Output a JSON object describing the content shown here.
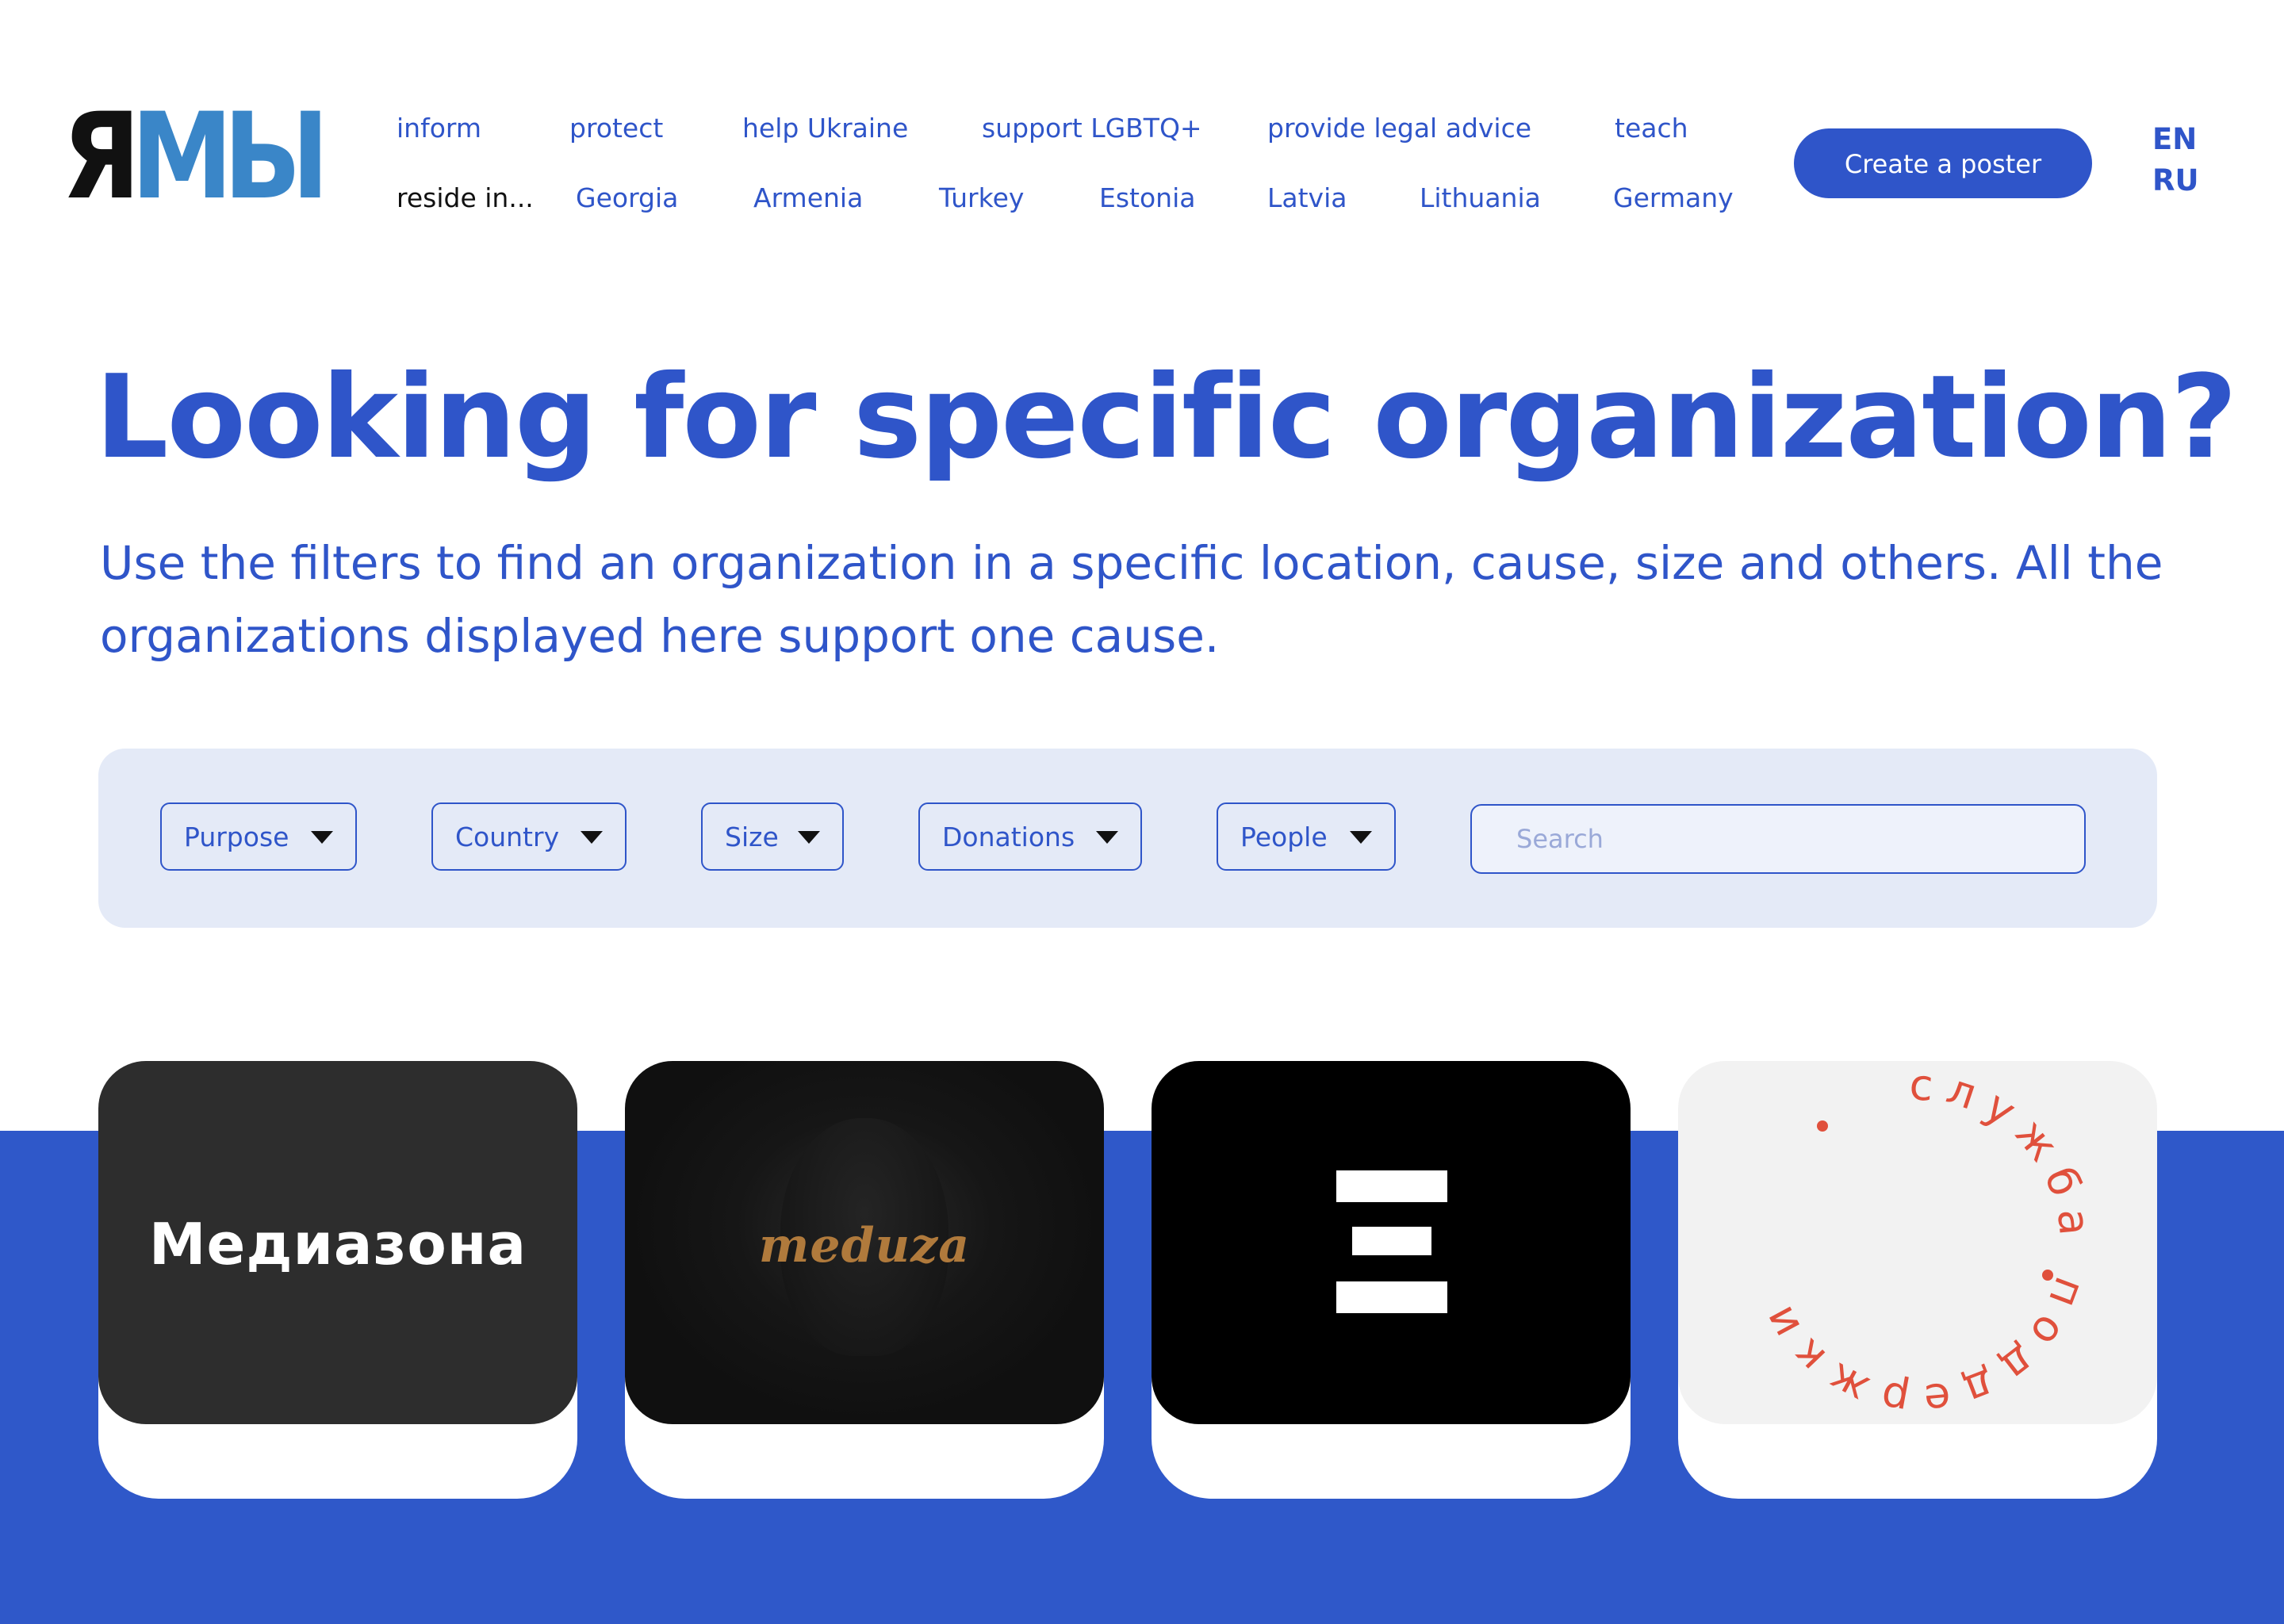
{
  "logo": {
    "part1": "Я",
    "part2": "МЫ"
  },
  "nav": {
    "row1": [
      "inform",
      "protect",
      "help Ukraine",
      "support LGBTQ+",
      "provide legal advice",
      "teach"
    ],
    "reside_label": "reside in...",
    "row2": [
      "Georgia",
      "Armenia",
      "Turkey",
      "Estonia",
      "Latvia",
      "Lithuania",
      "Germany"
    ]
  },
  "header": {
    "cta_label": "Create a poster",
    "languages": [
      "EN",
      "RU"
    ]
  },
  "hero": {
    "title": "Looking for specific organization?",
    "subtitle": "Use the filters to find an organization in a specific location, cause, size and others. All the organizations displayed here support one cause."
  },
  "filters": {
    "items": [
      "Purpose",
      "Country",
      "Size",
      "Donations",
      "People"
    ],
    "search_placeholder": "Search"
  },
  "cards": [
    {
      "logo_text": "Медиазона"
    },
    {
      "logo_text": "meduza"
    },
    {
      "logo_text": ""
    },
    {
      "logo_text": "служба поддержки"
    }
  ],
  "colors": {
    "brand_blue": "#2f55c9",
    "band_blue": "#2f58c9",
    "filter_bg": "#e4eaf7",
    "logo_light_blue": "#3a86c8",
    "support_red": "#e0503c",
    "meduza_gold": "#b07a3c"
  }
}
